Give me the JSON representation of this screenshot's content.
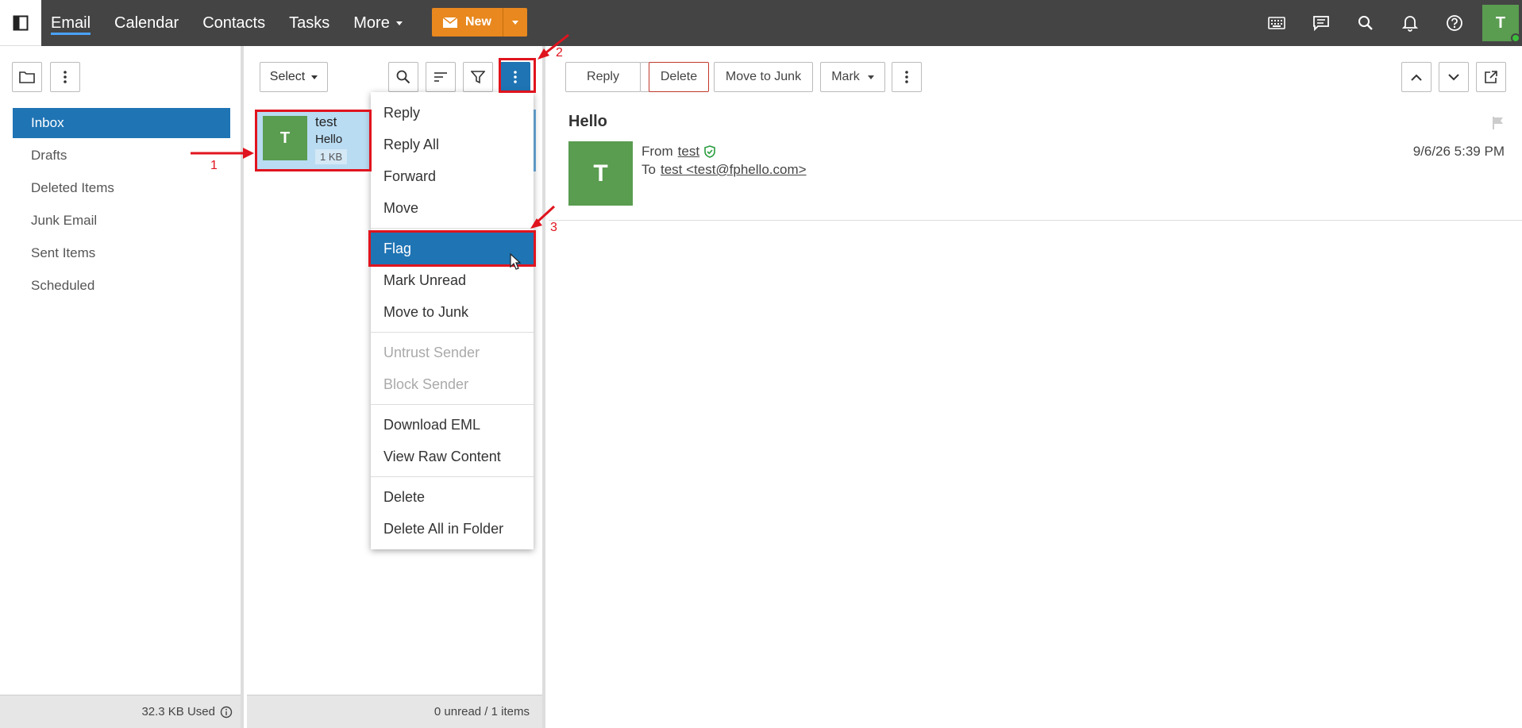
{
  "topbar": {
    "nav": [
      "Email",
      "Calendar",
      "Contacts",
      "Tasks",
      "More"
    ],
    "new_label": "New",
    "avatar_initial": "T",
    "accent_color": "#e8881e",
    "icons": [
      "keyboard-icon",
      "chat-icon",
      "search-icon",
      "bell-icon",
      "help-icon"
    ]
  },
  "folders": {
    "items": [
      "Inbox",
      "Drafts",
      "Deleted Items",
      "Junk Email",
      "Sent Items",
      "Scheduled"
    ],
    "active": "Inbox",
    "storage_used": "32.3 KB Used"
  },
  "message_list": {
    "select_label": "Select",
    "messages": [
      {
        "initial": "T",
        "sender": "test",
        "subject": "Hello",
        "size": "1 KB"
      }
    ],
    "footer": "0 unread / 1 items"
  },
  "context_menu": {
    "groups": [
      [
        "Reply",
        "Reply All",
        "Forward",
        "Move"
      ],
      [
        "Flag",
        "Mark Unread",
        "Move to Junk"
      ],
      [
        "Untrust Sender",
        "Block Sender"
      ],
      [
        "Download EML",
        "View Raw Content"
      ],
      [
        "Delete",
        "Delete All in Folder"
      ]
    ],
    "hovered": "Flag",
    "disabled": [
      "Untrust Sender",
      "Block Sender"
    ]
  },
  "reading_pane": {
    "toolbar": {
      "reply": "Reply",
      "delete": "Delete",
      "move_to_junk": "Move to Junk",
      "mark": "Mark"
    },
    "subject": "Hello",
    "avatar_initial": "T",
    "from_prefix": "From",
    "from_name": "test",
    "to_prefix": "To",
    "to_address": "test <test@fphello.com>",
    "date": "9/6/26 5:39 PM"
  },
  "annotations": {
    "labels": [
      "1",
      "2",
      "3"
    ],
    "color": "#e0141e"
  }
}
